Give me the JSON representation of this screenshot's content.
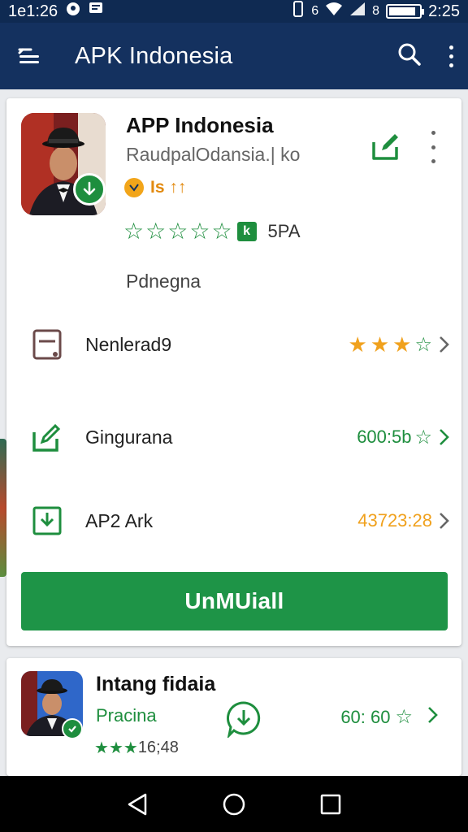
{
  "status_bar": {
    "time_left": "1e1:26",
    "time_right": "2:25",
    "signal_text": "6",
    "battery_text": "8",
    "battery_level": 0.88
  },
  "app_bar": {
    "title": "APK Indonesia",
    "icons": [
      "menu-icon",
      "search-icon",
      "more-vert-icon"
    ]
  },
  "app_card": {
    "title": "APP Indonesia",
    "developer": "RaudpalOdansia.| ko",
    "badge_text": "Is ↑↑",
    "rating_stars": 5,
    "rating_badge": "k",
    "rating_count": "5PA",
    "category": "Pdnegna",
    "rows": [
      {
        "icon": "document-icon",
        "label": "Nenlerad9",
        "stars_filled": 3,
        "stars_total": 4
      },
      {
        "icon": "edit-icon",
        "label": "Gingurana",
        "value": "600:5b",
        "value_color": "#1e8e3e"
      },
      {
        "icon": "download-box-icon",
        "label": "AP2 Ark",
        "value": "43723:28",
        "value_color": "#f0a11d"
      }
    ],
    "primary_button": "UnMUiall"
  },
  "second_card": {
    "title": "Intang fidaia",
    "subtitle": "Pracina",
    "rating_text": "16;48",
    "rating_stars": 3,
    "value": "60: 60"
  },
  "colors": {
    "app_bar": "#14315f",
    "status_bar": "#0f2a52",
    "accent_green": "#1e8e3e",
    "button_green": "#1e9447",
    "star_orange": "#f0a11d"
  }
}
